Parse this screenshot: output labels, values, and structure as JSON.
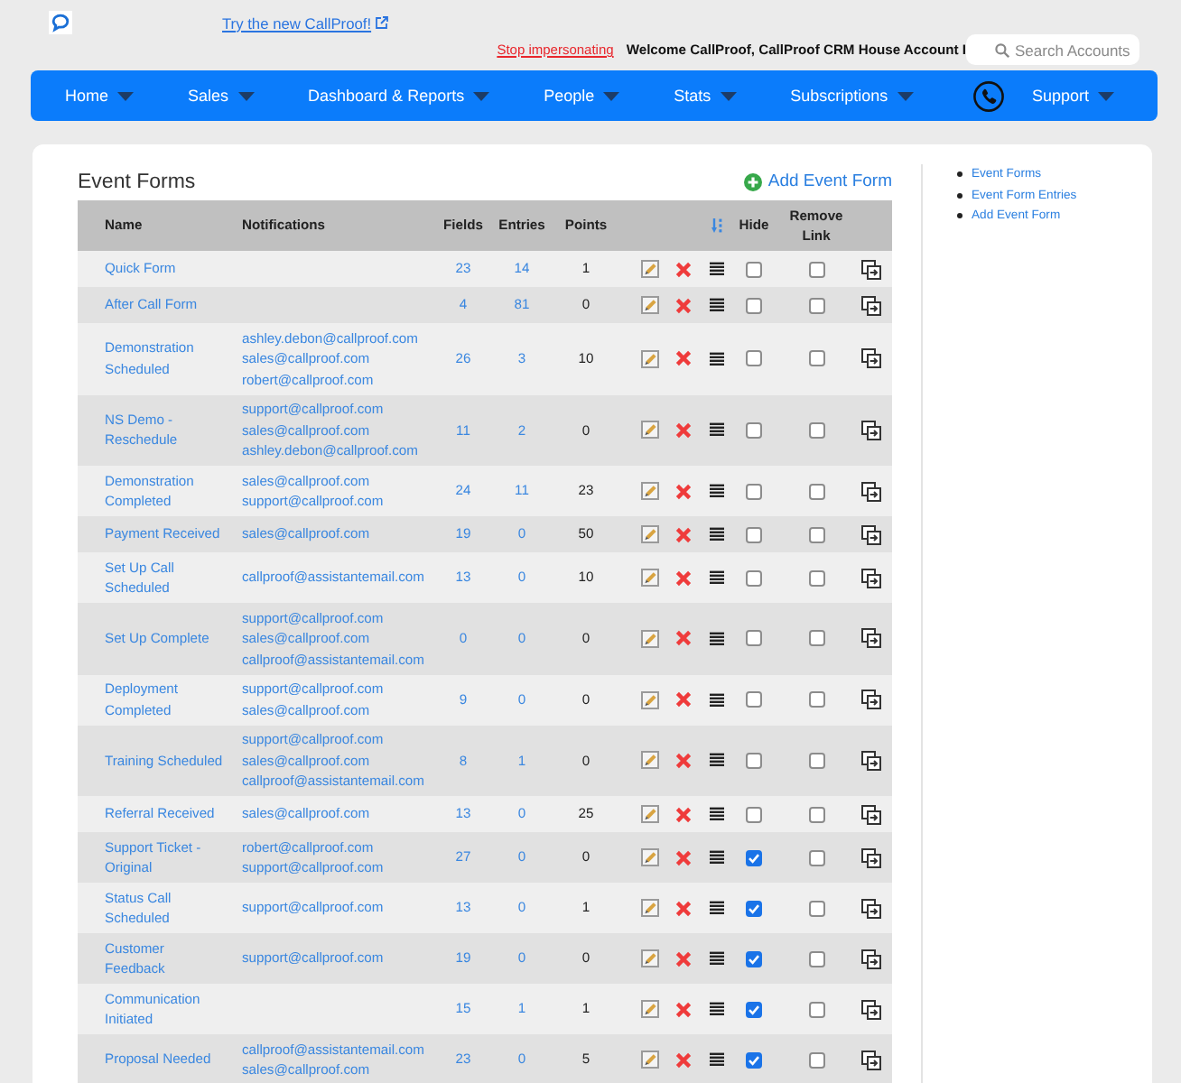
{
  "header": {
    "try_link": "Try the new CallProof!",
    "stop_link": "Stop impersonating",
    "welcome": "Welcome CallProof, CallProof CRM House Account I",
    "search": {
      "placeholder": "Search Accounts"
    }
  },
  "nav": {
    "items": [
      {
        "kind": "menu",
        "label": "Home"
      },
      {
        "kind": "menu",
        "label": "Sales"
      },
      {
        "kind": "menu",
        "label": "Dashboard & Reports"
      },
      {
        "kind": "menu",
        "label": "People"
      },
      {
        "kind": "menu",
        "label": "Stats"
      },
      {
        "kind": "menu",
        "label": "Subscriptions"
      },
      {
        "kind": "phone"
      },
      {
        "kind": "menu",
        "label": "Support"
      }
    ]
  },
  "content": {
    "title": "Event Forms",
    "add_link": "Add Event Form"
  },
  "table": {
    "columns": [
      {
        "kind": "text",
        "label": "Name"
      },
      {
        "kind": "text",
        "label": "Notifications"
      },
      {
        "kind": "text",
        "label": "Fields"
      },
      {
        "kind": "text",
        "label": "Entries"
      },
      {
        "kind": "text",
        "label": "Points"
      },
      {
        "kind": "blank"
      },
      {
        "kind": "blank"
      },
      {
        "kind": "sort"
      },
      {
        "kind": "text",
        "label": "Hide"
      },
      {
        "kind": "text",
        "label": "Remove Link"
      },
      {
        "kind": "blank"
      }
    ],
    "rows": [
      {
        "name": "Quick Form",
        "fields": "23",
        "entries": "14",
        "points": "1",
        "hide": false,
        "remove_link": false
      },
      {
        "name": "After Call Form",
        "fields": "4",
        "entries": "81",
        "points": "0",
        "hide": false,
        "remove_link": false
      },
      {
        "name": "Demonstration Scheduled",
        "notifications": [
          "ashley.debon@callproof.com",
          "sales@callproof.com",
          "robert@callproof.com"
        ],
        "fields": "26",
        "entries": "3",
        "points": "10",
        "hide": false,
        "remove_link": false
      },
      {
        "name": "NS Demo - Reschedule",
        "notifications": [
          "support@callproof.com",
          "sales@callproof.com",
          "ashley.debon@callproof.com"
        ],
        "fields": "11",
        "entries": "2",
        "points": "0",
        "hide": false,
        "remove_link": false
      },
      {
        "name": "Demonstration Completed",
        "notifications": [
          "sales@callproof.com",
          "support@callproof.com"
        ],
        "fields": "24",
        "entries": "11",
        "points": "23",
        "hide": false,
        "remove_link": false
      },
      {
        "name": "Payment Received",
        "notifications": [
          "sales@callproof.com"
        ],
        "fields": "19",
        "entries": "0",
        "points": "50",
        "hide": false,
        "remove_link": false
      },
      {
        "name": "Set Up Call Scheduled",
        "notifications": [
          "callproof@assistantemail.com"
        ],
        "fields": "13",
        "entries": "0",
        "points": "10",
        "hide": false,
        "remove_link": false
      },
      {
        "name": "Set Up Complete",
        "notifications": [
          "support@callproof.com",
          "sales@callproof.com",
          "callproof@assistantemail.com"
        ],
        "fields": "0",
        "entries": "0",
        "points": "0",
        "hide": false,
        "remove_link": false
      },
      {
        "name": "Deployment Completed",
        "notifications": [
          "support@callproof.com",
          "sales@callproof.com"
        ],
        "fields": "9",
        "entries": "0",
        "points": "0",
        "hide": false,
        "remove_link": false
      },
      {
        "name": "Training Scheduled",
        "notifications": [
          "support@callproof.com",
          "sales@callproof.com",
          "callproof@assistantemail.com"
        ],
        "fields": "8",
        "entries": "1",
        "points": "0",
        "hide": false,
        "remove_link": false
      },
      {
        "name": "Referral Received",
        "notifications": [
          "sales@callproof.com"
        ],
        "fields": "13",
        "entries": "0",
        "points": "25",
        "hide": false,
        "remove_link": false
      },
      {
        "name": "Support Ticket - Original",
        "notifications": [
          "robert@callproof.com",
          "support@callproof.com"
        ],
        "fields": "27",
        "entries": "0",
        "points": "0",
        "hide": true,
        "remove_link": false
      },
      {
        "name": "Status Call Scheduled",
        "notifications": [
          "support@callproof.com"
        ],
        "fields": "13",
        "entries": "0",
        "points": "1",
        "hide": true,
        "remove_link": false
      },
      {
        "name": "Customer Feedback",
        "notifications": [
          "support@callproof.com"
        ],
        "fields": "19",
        "entries": "0",
        "points": "0",
        "hide": true,
        "remove_link": false
      },
      {
        "name": "Communication Initiated",
        "fields": "15",
        "entries": "1",
        "points": "1",
        "hide": true,
        "remove_link": false
      },
      {
        "name": "Proposal Needed",
        "notifications": [
          "callproof@assistantemail.com",
          "sales@callproof.com"
        ],
        "fields": "23",
        "entries": "0",
        "points": "5",
        "hide": true,
        "remove_link": false
      }
    ]
  },
  "sidebar": {
    "links": [
      "Event Forms",
      "Event Form Entries",
      "Add Event Form"
    ]
  }
}
